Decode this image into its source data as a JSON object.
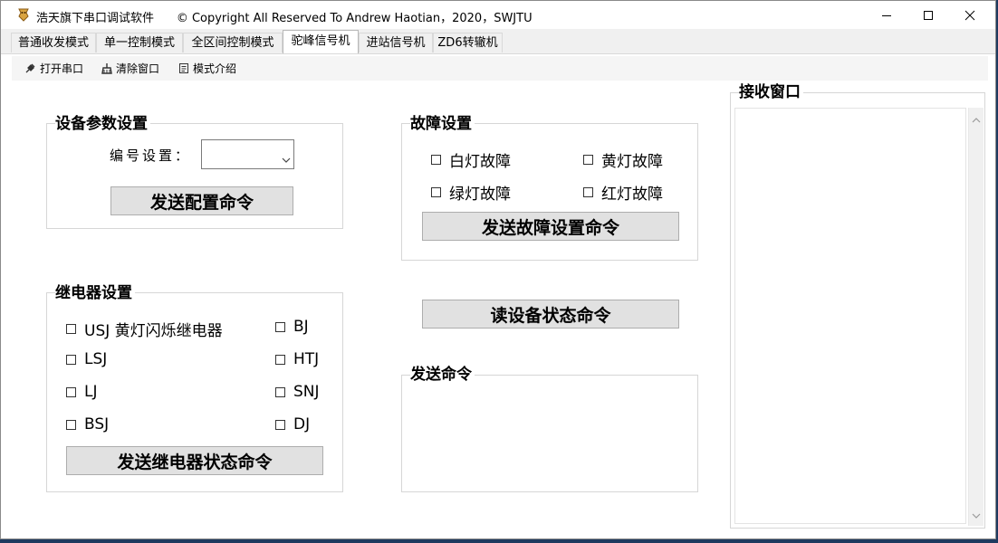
{
  "window": {
    "title": "浩天旗下串口调试软件",
    "copyright": "© Copyright All Reserved To Andrew Haotian，2020，SWJTU",
    "controls": {
      "minimize": "minimize-icon",
      "maximize": "maximize-icon",
      "close": "close-icon"
    }
  },
  "tabs": [
    {
      "label": "普通收发模式",
      "active": false
    },
    {
      "label": "单一控制模式",
      "active": false
    },
    {
      "label": "全区间控制模式",
      "active": false
    },
    {
      "label": "驼峰信号机",
      "active": true
    },
    {
      "label": "进站信号机",
      "active": false
    },
    {
      "label": "ZD6转辙机",
      "active": false
    }
  ],
  "toolbar": {
    "open_port": "打开串口",
    "clear_window": "清除窗口",
    "mode_intro": "模式介绍"
  },
  "device_params": {
    "title": "设备参数设置",
    "id_label": "编号设置：",
    "id_value": "",
    "send_button": "发送配置命令"
  },
  "fault": {
    "title": "故障设置",
    "items": [
      {
        "label": "白灯故障",
        "checked": false
      },
      {
        "label": "黄灯故障",
        "checked": false
      },
      {
        "label": "绿灯故障",
        "checked": false
      },
      {
        "label": "红灯故障",
        "checked": false
      }
    ],
    "send_button": "发送故障设置命令"
  },
  "relay": {
    "title": "继电器设置",
    "items": [
      {
        "label": "USJ 黄灯闪烁继电器",
        "checked": false
      },
      {
        "label": "BJ",
        "checked": false
      },
      {
        "label": "LSJ",
        "checked": false
      },
      {
        "label": "HTJ",
        "checked": false
      },
      {
        "label": "LJ",
        "checked": false
      },
      {
        "label": "SNJ",
        "checked": false
      },
      {
        "label": "BSJ",
        "checked": false
      },
      {
        "label": "DJ",
        "checked": false
      }
    ],
    "send_button": "发送继电器状态命令"
  },
  "read_status_button": "读设备状态命令",
  "send_cmd": {
    "title": "发送命令",
    "text": ""
  },
  "receive": {
    "title": "接收窗口",
    "text": ""
  },
  "colors": {
    "button_bg": "#e1e1e1",
    "window_bg": "#ffffff",
    "tabstrip_bg": "#f0f0f0"
  }
}
